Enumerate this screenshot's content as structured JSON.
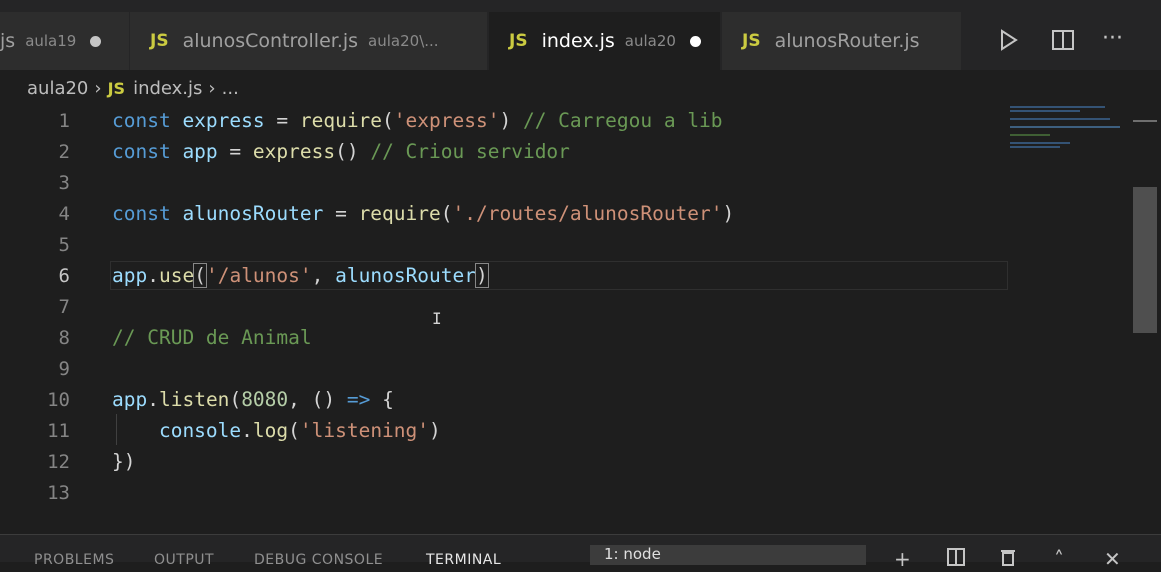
{
  "tabs": [
    {
      "name": "js",
      "desc": "aula19",
      "js": "",
      "dirty": true
    },
    {
      "name": "alunosController.js",
      "desc": "aula20\\...",
      "js": "JS",
      "dirty": false
    },
    {
      "name": "index.js",
      "desc": "aula20",
      "js": "JS",
      "dirty": true,
      "active": true
    },
    {
      "name": "alunosRouter.js",
      "desc": "",
      "js": "JS",
      "dirty": false
    }
  ],
  "toolbar": {
    "run_icon": "play-icon",
    "split_icon": "split-editor-icon",
    "more_icon": "more-icon"
  },
  "breadcrumb": {
    "folder": "aula20",
    "js_badge": "JS",
    "file": "index.js",
    "rest": "..."
  },
  "editor": {
    "lines": [
      {
        "n": "1"
      },
      {
        "n": "2"
      },
      {
        "n": "3"
      },
      {
        "n": "4"
      },
      {
        "n": "5"
      },
      {
        "n": "6"
      },
      {
        "n": "7"
      },
      {
        "n": "8"
      },
      {
        "n": "9"
      },
      {
        "n": "10"
      },
      {
        "n": "11"
      },
      {
        "n": "12"
      },
      {
        "n": "13"
      }
    ],
    "code": {
      "l1": {
        "a": "const",
        "b": " express",
        "c": " = ",
        "d": "require",
        "e": "(",
        "f": "'express'",
        "g": ") ",
        "h": "// Carregou a lib"
      },
      "l2": {
        "a": "const",
        "b": " app",
        "c": " = ",
        "d": "express",
        "e": "() ",
        "f": "// Criou servidor"
      },
      "l4": {
        "a": "const",
        "b": " alunosRouter",
        "c": " = ",
        "d": "require",
        "e": "(",
        "f": "'./routes/alunosRouter'",
        "g": ")"
      },
      "l6": {
        "a": "app",
        "b": ".",
        "c": "use",
        "d": "(",
        "e": "'/alunos'",
        "f": ", ",
        "g": "alunosRouter",
        "h": ")"
      },
      "l8": {
        "a": "// CRUD de Animal"
      },
      "l10": {
        "a": "app",
        "b": ".",
        "c": "listen",
        "d": "(",
        "e": "8080",
        "f": ", () ",
        "g": "=>",
        "h": " {"
      },
      "l11": {
        "a": "    console",
        "b": ".",
        "c": "log",
        "d": "(",
        "e": "'listening'",
        "f": ")"
      },
      "l12": {
        "a": "})"
      }
    }
  },
  "panel": {
    "tabs": [
      "PROBLEMS",
      "OUTPUT",
      "DEBUG CONSOLE",
      "TERMINAL"
    ],
    "active_tab": "TERMINAL",
    "terminal_select": "1: node"
  },
  "colors": {
    "keyword": "#569cd6",
    "variable": "#9cdcfe",
    "function": "#dcdcaa",
    "string": "#ce9178",
    "comment": "#6a9955",
    "number": "#b5cea8",
    "js_badge": "#cbcb41"
  }
}
